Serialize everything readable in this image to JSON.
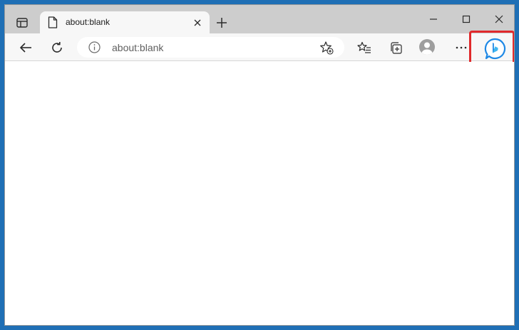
{
  "tab": {
    "title": "about:blank"
  },
  "address_bar": {
    "url": "about:blank"
  },
  "icons": {
    "tab_actions": "tab-actions-icon",
    "page": "page-icon",
    "tab_close": "close-icon",
    "new_tab": "plus-icon",
    "minimize": "minimize-icon",
    "maximize": "maximize-icon",
    "close": "close-icon",
    "back": "back-arrow-icon",
    "refresh": "refresh-icon",
    "site_info": "info-icon",
    "add_favorite": "star-plus-icon",
    "favorites": "favorites-icon",
    "collections": "collections-icon",
    "profile": "avatar",
    "more": "ellipsis-icon",
    "bing_chat": "bing-copilot-icon"
  },
  "colors": {
    "desktop": "#1f6fb5",
    "titlebar": "#cdcdcd",
    "toolbar": "#f7f7f7",
    "highlight_box": "#e0292b",
    "bing_blue": "#1e88e5"
  }
}
